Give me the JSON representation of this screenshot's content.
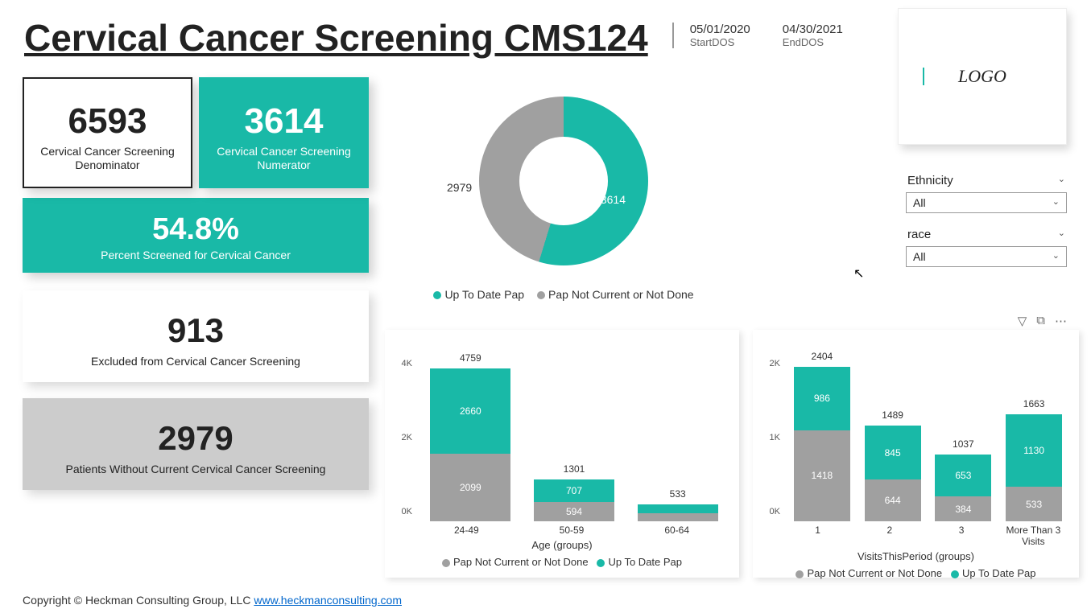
{
  "title": "Cervical Cancer Screening CMS124",
  "dates": {
    "start": "05/01/2020",
    "start_label": "StartDOS",
    "end": "04/30/2021",
    "end_label": "EndDOS"
  },
  "logo_text": "LOGO",
  "kpi": {
    "denominator": {
      "value": "6593",
      "label": "Cervical Cancer Screening Denominator"
    },
    "numerator": {
      "value": "3614",
      "label": "Cervical Cancer Screening Numerator"
    },
    "percent": {
      "value": "54.8%",
      "label": "Percent Screened for Cervical Cancer"
    },
    "excluded": {
      "value": "913",
      "label": "Excluded from Cervical Cancer Screening"
    },
    "without": {
      "value": "2979",
      "label": "Patients Without Current Cervical Cancer Screening"
    }
  },
  "donut_legend": {
    "a": "Up To Date Pap",
    "b": "Pap Not Current or Not Done",
    "val_a": "3614",
    "val_b": "2979"
  },
  "filters": {
    "ethnicity_label": "Ethnicity",
    "ethnicity_value": "All",
    "race_label": "race",
    "race_value": "All"
  },
  "chart_data": [
    {
      "id": "donut",
      "type": "pie",
      "title": "",
      "series": [
        {
          "name": "Up To Date Pap",
          "value": 3614
        },
        {
          "name": "Pap Not Current or Not Done",
          "value": 2979
        }
      ]
    },
    {
      "id": "age",
      "type": "bar",
      "stacked": true,
      "xlabel": "Age (groups)",
      "ylabel": "",
      "ylim": [
        0,
        5000
      ],
      "yticks": [
        "0K",
        "2K",
        "4K"
      ],
      "categories": [
        "24-49",
        "50-59",
        "60-64"
      ],
      "totals": [
        4759,
        1301,
        533
      ],
      "series": [
        {
          "name": "Pap Not Current or Not Done",
          "values": [
            2099,
            594,
            260
          ]
        },
        {
          "name": "Up To Date Pap",
          "values": [
            2660,
            707,
            273
          ]
        }
      ],
      "legend": [
        "Pap Not Current or Not Done",
        "Up To Date Pap"
      ]
    },
    {
      "id": "visits",
      "type": "bar",
      "stacked": true,
      "xlabel": "VisitsThisPeriod (groups)",
      "ylabel": "",
      "ylim": [
        0,
        2500
      ],
      "yticks": [
        "0K",
        "1K",
        "2K"
      ],
      "categories": [
        "1",
        "2",
        "3",
        "More Than 3 Visits"
      ],
      "totals": [
        2404,
        1489,
        1037,
        1663
      ],
      "series": [
        {
          "name": "Pap Not Current or Not Done",
          "values": [
            1418,
            644,
            384,
            533
          ]
        },
        {
          "name": "Up To Date Pap",
          "values": [
            986,
            845,
            653,
            1130
          ]
        }
      ],
      "legend": [
        "Pap Not Current or Not Done",
        "Up To Date Pap"
      ]
    }
  ],
  "footer": {
    "text": "Copyright © Heckman Consulting Group, LLC ",
    "link_text": "www.heckmanconsulting.com"
  }
}
